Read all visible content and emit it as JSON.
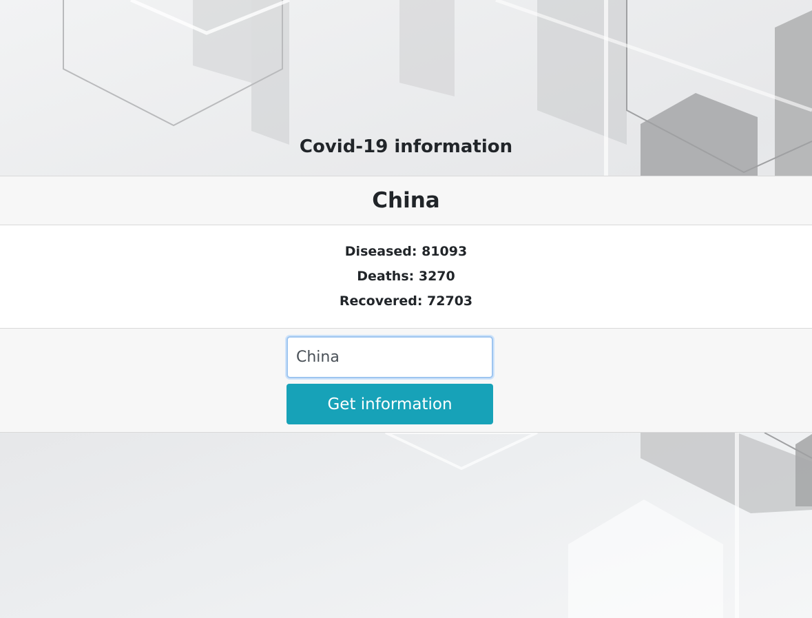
{
  "header": {
    "title": "Covid-19 information"
  },
  "result": {
    "country": "China",
    "stats": {
      "diseased_label": "Diseased: 81093",
      "deaths_label": "Deaths: 3270",
      "recovered_label": "Recovered: 72703"
    }
  },
  "form": {
    "country_value": "China",
    "submit_label": "Get information"
  },
  "colors": {
    "accent_button": "#17a2b8",
    "input_focus_border": "#9ec5f0",
    "card_header_bg": "#f7f7f7"
  }
}
